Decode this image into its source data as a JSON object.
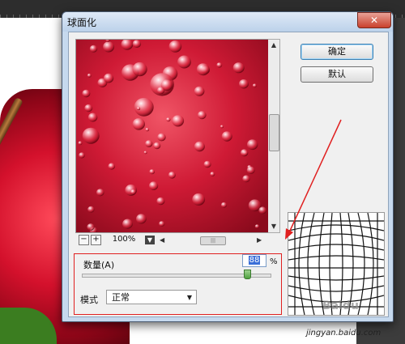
{
  "dialog": {
    "title": "球面化",
    "close_glyph": "✕",
    "ok_label": "确定",
    "default_label": "默认"
  },
  "preview": {
    "zoom_out_glyph": "−",
    "zoom_in_glyph": "+",
    "zoom_value": "100%"
  },
  "amount": {
    "label": "数量(A)",
    "value": "88",
    "unit": "%",
    "level": 0.88
  },
  "mode": {
    "label": "模式",
    "selected": "正常",
    "arrow_glyph": "▼"
  },
  "watermark": {
    "text": "jingyan.baidu.com",
    "logo_text": "Baidu"
  },
  "colors": {
    "annotation_red": "#e02020",
    "apple_red": "#c41a32",
    "dialog_chrome": "#c6d9ee",
    "ok_focus": "#3c7fb1"
  },
  "icons": {
    "close": "close-icon",
    "zoom_out": "minus-icon",
    "zoom_in": "plus-icon",
    "dropdown": "chevron-down-icon"
  }
}
